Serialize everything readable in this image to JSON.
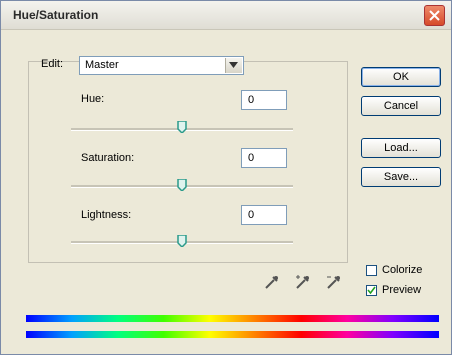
{
  "window": {
    "title": "Hue/Saturation"
  },
  "edit": {
    "label": "Edit:",
    "value": "Master"
  },
  "hue": {
    "label": "Hue:",
    "value": "0",
    "level": 0
  },
  "saturation": {
    "label": "Saturation:",
    "value": "0",
    "level": 0
  },
  "lightness": {
    "label": "Lightness:",
    "value": "0",
    "level": 0
  },
  "buttons": {
    "ok": "OK",
    "cancel": "Cancel",
    "load": "Load...",
    "save": "Save..."
  },
  "colorize": {
    "label": "Colorize",
    "checked": false
  },
  "preview": {
    "label": "Preview",
    "checked": true
  },
  "colors": {
    "slider_thumb": "#2a9a8a",
    "button_border": "#003c74",
    "field_border": "#7f9db9"
  },
  "icons": [
    "eyedropper-icon",
    "eyedropper-plus-icon",
    "eyedropper-minus-icon",
    "close-icon",
    "chevron-down-icon"
  ]
}
